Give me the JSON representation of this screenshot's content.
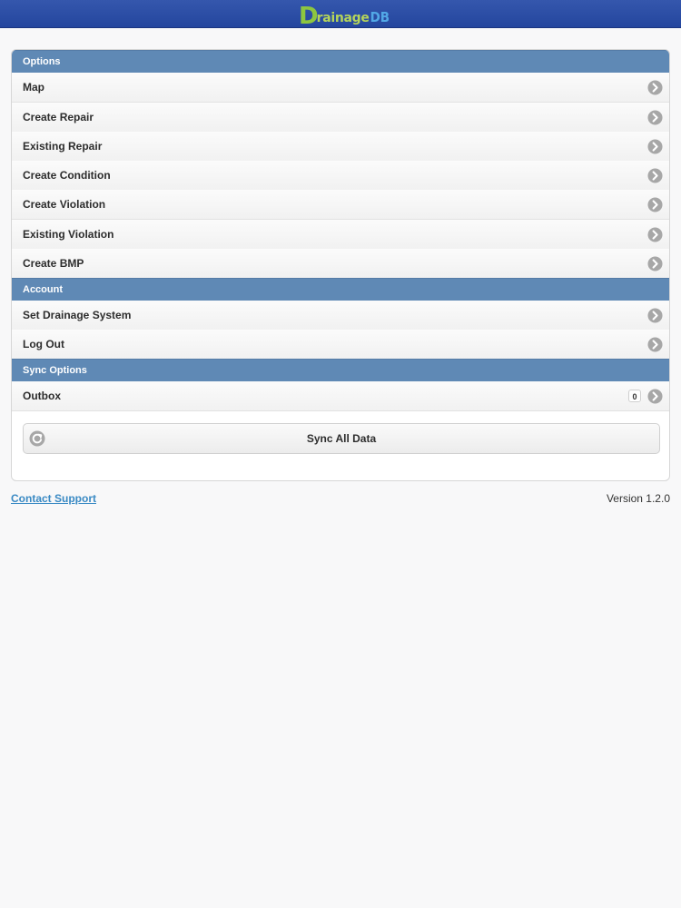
{
  "header": {
    "logo": {
      "d": "D",
      "rest": "rainage",
      "db": "DB"
    },
    "colors": {
      "bar": "#2a4ba2",
      "logo_green": "#8dc63f",
      "logo_blue": "#52a8e6"
    }
  },
  "sections": {
    "options": {
      "title": "Options",
      "items": [
        {
          "label": "Map"
        },
        {
          "label": "Create Repair"
        },
        {
          "label": "Existing Repair"
        },
        {
          "label": "Create Condition"
        },
        {
          "label": "Create Violation"
        },
        {
          "label": "Existing Violation"
        },
        {
          "label": "Create BMP"
        }
      ]
    },
    "account": {
      "title": "Account",
      "items": [
        {
          "label": "Set Drainage System"
        },
        {
          "label": "Log Out"
        }
      ]
    },
    "sync": {
      "title": "Sync Options",
      "outbox": {
        "label": "Outbox",
        "count": "0"
      },
      "sync_all_label": "Sync All Data"
    }
  },
  "footer": {
    "contact_label": "Contact Support",
    "version": "Version 1.2.0"
  },
  "icons": {
    "row_arrow": "chevron-right-icon",
    "sync": "refresh-icon"
  },
  "accent_color": "#5f89b5"
}
